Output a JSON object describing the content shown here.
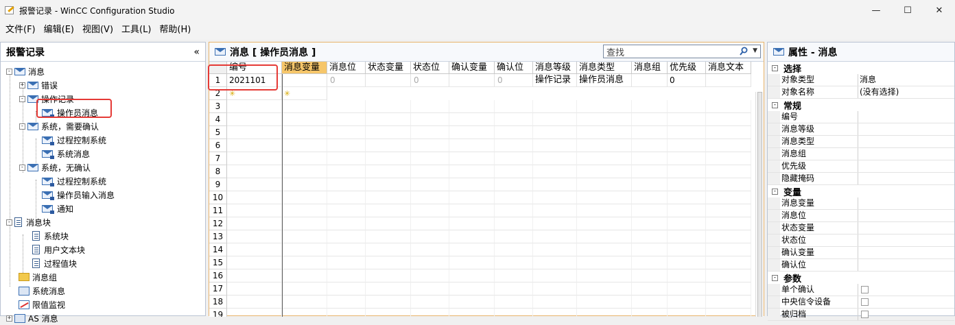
{
  "window": {
    "title": "报警记录 - WinCC Configuration Studio",
    "min": "—",
    "max": "☐",
    "close": "✕"
  },
  "menu": [
    "文件(F)",
    "编辑(E)",
    "视图(V)",
    "工具(L)",
    "帮助(H)"
  ],
  "left_panel": {
    "title": "报警记录",
    "collapse": "«",
    "tree": [
      "消息",
      "错误",
      "操作记录",
      "操作员消息",
      "系统，需要确认",
      "过程控制系统",
      "系统消息",
      "系统，无确认",
      "过程控制系统",
      "操作员输入消息",
      "通知",
      "消息块",
      "系统块",
      "用户文本块",
      "过程值块",
      "消息组",
      "系统消息",
      "限值监视",
      "AS 消息"
    ]
  },
  "center_panel": {
    "title": "消息 [ 操作员消息 ]",
    "search_placeholder": "查找",
    "columns": [
      "编号",
      "消息变量",
      "消息位",
      "状态变量",
      "状态位",
      "确认变量",
      "确认位",
      "消息等级",
      "消息类型",
      "消息组",
      "优先级",
      "消息文本"
    ],
    "row1": [
      "2021101",
      "",
      "0",
      "",
      "0",
      "",
      "0",
      "操作记录",
      "操作员消息",
      "",
      "0",
      ""
    ],
    "row_numbers": [
      "1",
      "2",
      "3",
      "4",
      "5",
      "6",
      "7",
      "8",
      "9",
      "10",
      "11",
      "12",
      "13",
      "14",
      "15",
      "16",
      "17",
      "18",
      "19"
    ]
  },
  "right_panel": {
    "title": "属性 - 消息",
    "sections": {
      "select": "选择",
      "general": "常规",
      "tags": "变量",
      "params": "参数"
    },
    "select_rows": [
      [
        "对象类型",
        "消息"
      ],
      [
        "对象名称",
        "(没有选择)"
      ]
    ],
    "general_rows": [
      "编号",
      "消息等级",
      "消息类型",
      "消息组",
      "优先级",
      "隐藏掩码"
    ],
    "tag_rows": [
      "消息变量",
      "消息位",
      "状态变量",
      "状态位",
      "确认变量",
      "确认位"
    ],
    "param_rows": [
      "单个确认",
      "中央信令设备",
      "被归档"
    ]
  },
  "colors": {
    "accent": "#f6c66a",
    "highlight": "#e53935",
    "border": "#b9c3d2"
  }
}
